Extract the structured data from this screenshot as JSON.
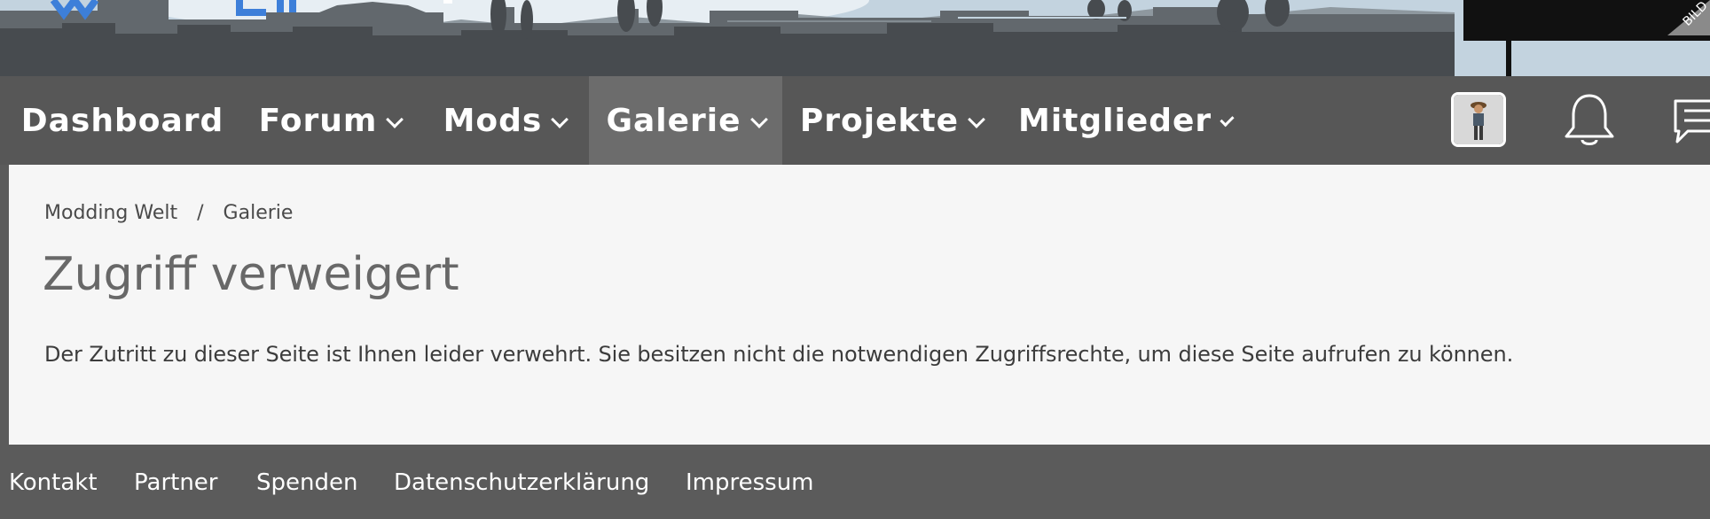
{
  "nav": {
    "items": [
      {
        "label": "Dashboard",
        "has_dropdown": false,
        "active": false
      },
      {
        "label": "Forum",
        "has_dropdown": true,
        "active": false
      },
      {
        "label": "Mods",
        "has_dropdown": true,
        "active": false
      },
      {
        "label": "Galerie",
        "has_dropdown": true,
        "active": true
      },
      {
        "label": "Projekte",
        "has_dropdown": true,
        "active": false
      },
      {
        "label": "Mitglieder",
        "has_dropdown": true,
        "active": false
      }
    ],
    "icons": [
      "avatar",
      "bell-icon",
      "chat-icon"
    ]
  },
  "header": {
    "corner_badge": "BILD"
  },
  "breadcrumb": {
    "items": [
      "Modding Welt",
      "Galerie"
    ],
    "separator": "/"
  },
  "main": {
    "title": "Zugriff verweigert",
    "message": "Der Zutritt zu dieser Seite ist Ihnen leider verwehrt. Sie besitzen nicht die notwendigen Zugriffsrechte, um diese Seite aufrufen zu können."
  },
  "footer": {
    "links": [
      "Kontakt",
      "Partner",
      "Spenden",
      "Datenschutzerklärung",
      "Impressum"
    ]
  },
  "colors": {
    "nav_bg": "#575757",
    "nav_active_bg": "#6c6c6c",
    "content_bg": "#f6f6f6",
    "footer_bg": "#5b5b5b",
    "logo_blue": "#3d7fd9"
  }
}
